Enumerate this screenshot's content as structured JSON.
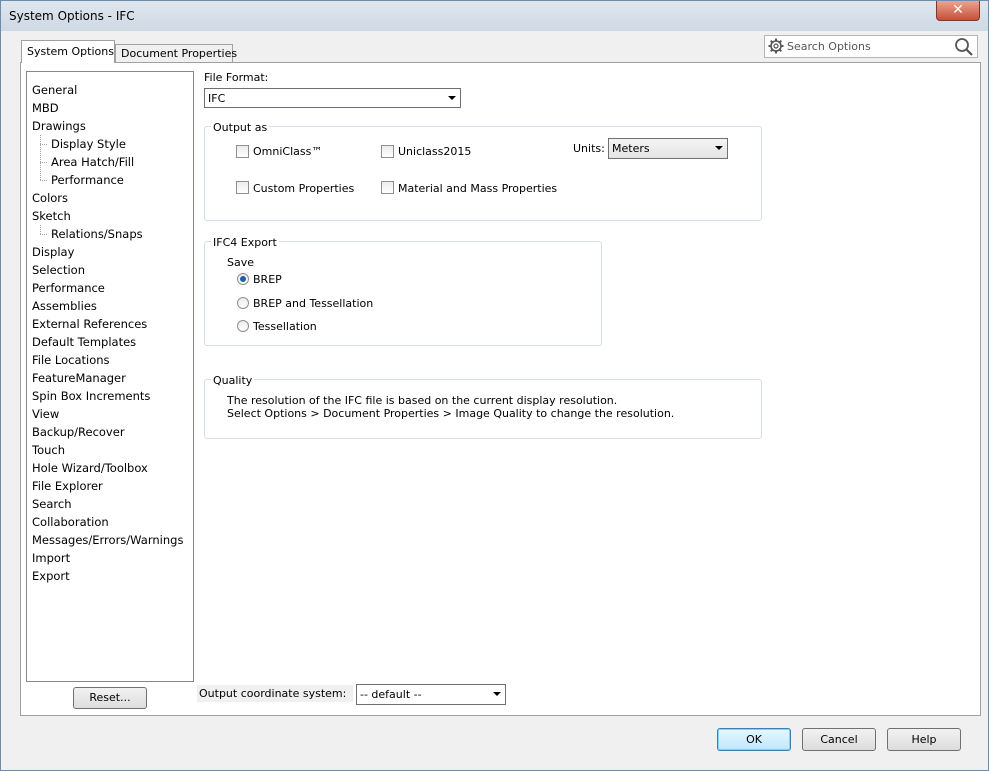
{
  "window": {
    "title": "System Options - IFC",
    "close_symbol": "✕"
  },
  "tabs": [
    {
      "label": "System Options",
      "active": true
    },
    {
      "label": "Document Properties",
      "active": false
    }
  ],
  "search": {
    "placeholder": "Search Options",
    "icon": "gear-icon",
    "action_icon": "magnifier-icon"
  },
  "nav": {
    "items": [
      {
        "label": "General",
        "level": 0
      },
      {
        "label": "MBD",
        "level": 0
      },
      {
        "label": "Drawings",
        "level": 0
      },
      {
        "label": "Display Style",
        "level": 1
      },
      {
        "label": "Area Hatch/Fill",
        "level": 1
      },
      {
        "label": "Performance",
        "level": 1
      },
      {
        "label": "Colors",
        "level": 0
      },
      {
        "label": "Sketch",
        "level": 0
      },
      {
        "label": "Relations/Snaps",
        "level": 1
      },
      {
        "label": "Display",
        "level": 0
      },
      {
        "label": "Selection",
        "level": 0
      },
      {
        "label": "Performance",
        "level": 0
      },
      {
        "label": "Assemblies",
        "level": 0
      },
      {
        "label": "External References",
        "level": 0
      },
      {
        "label": "Default Templates",
        "level": 0
      },
      {
        "label": "File Locations",
        "level": 0
      },
      {
        "label": "FeatureManager",
        "level": 0
      },
      {
        "label": "Spin Box Increments",
        "level": 0
      },
      {
        "label": "View",
        "level": 0
      },
      {
        "label": "Backup/Recover",
        "level": 0
      },
      {
        "label": "Touch",
        "level": 0
      },
      {
        "label": "Hole Wizard/Toolbox",
        "level": 0
      },
      {
        "label": "File Explorer",
        "level": 0
      },
      {
        "label": "Search",
        "level": 0
      },
      {
        "label": "Collaboration",
        "level": 0
      },
      {
        "label": "Messages/Errors/Warnings",
        "level": 0
      },
      {
        "label": "Import",
        "level": 0
      },
      {
        "label": "Export",
        "level": 0,
        "selected": true
      }
    ],
    "reset_label": "Reset..."
  },
  "file_format": {
    "label": "File Format:",
    "value": "IFC"
  },
  "output_as": {
    "title": "Output as",
    "omniclass": "OmniClass™",
    "uniclass": "Uniclass2015",
    "custom_props": "Custom Properties",
    "material_mass": "Material and Mass Properties",
    "units_label": "Units:",
    "units_value": "Meters"
  },
  "ifc4": {
    "title": "IFC4 Export",
    "save_label": "Save",
    "options": [
      "BREP",
      "BREP and Tessellation",
      "Tessellation"
    ],
    "selected": "BREP"
  },
  "quality": {
    "title": "Quality",
    "line1": "The resolution of the IFC file is based on the current display resolution.",
    "line2": "Select Options > Document Properties > Image Quality to change the resolution."
  },
  "coordinate": {
    "label": "Output coordinate system:",
    "value": "-- default --"
  },
  "buttons": {
    "ok": "OK",
    "cancel": "Cancel",
    "help": "Help"
  }
}
